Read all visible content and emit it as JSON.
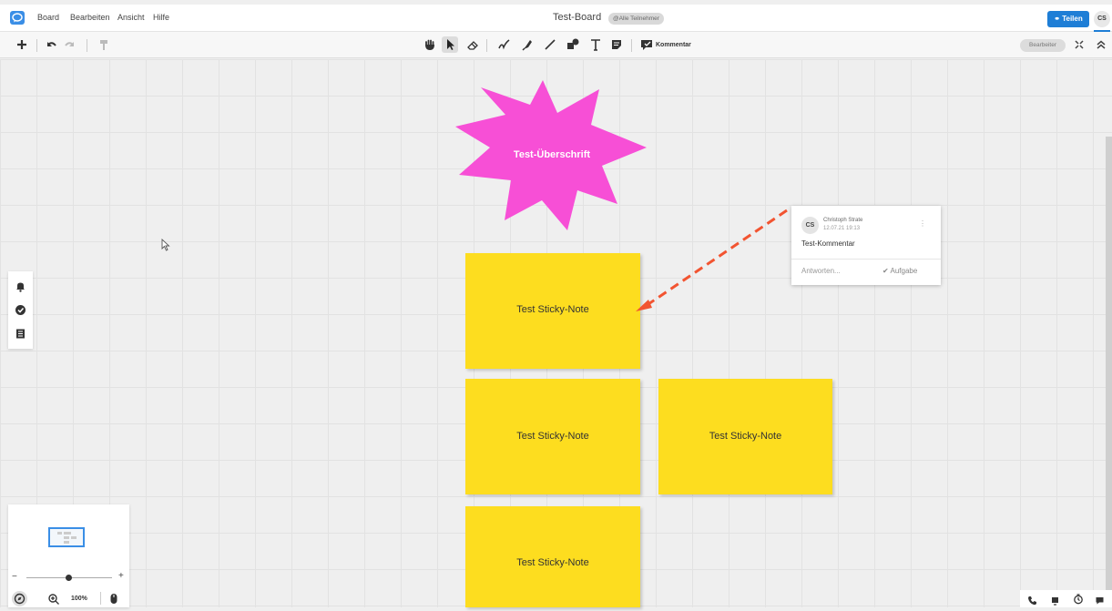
{
  "menu": {
    "items": [
      "Board",
      "Bearbeiten",
      "Ansicht",
      "Hilfe"
    ],
    "board_title": "Test-Board",
    "participants": "@Alle Teilnehmer",
    "share_label": "Teilen",
    "avatar_initials": "CS"
  },
  "toolbar": {
    "comment_label": "Kommentar",
    "edit_pill": "Bearbeiter"
  },
  "canvas": {
    "shape_text": "Test-Überschrift",
    "sticky_notes": [
      "Test Sticky-Note",
      "Test Sticky-Note",
      "Test Sticky-Note",
      "Test Sticky-Note"
    ]
  },
  "comment": {
    "avatar": "CS",
    "author": "Christoph Strate",
    "date": "12.07.21 19:13",
    "text": "Test-Kommentar",
    "reply_placeholder": "Antworten...",
    "task_label": "Aufgabe"
  },
  "zoom": {
    "percent": "100%",
    "minus": "−",
    "plus": "+"
  },
  "colors": {
    "accent": "#1e7ed6",
    "sticky": "#fddd1f",
    "shape": "#f74fd6",
    "arrow": "#f25431"
  }
}
